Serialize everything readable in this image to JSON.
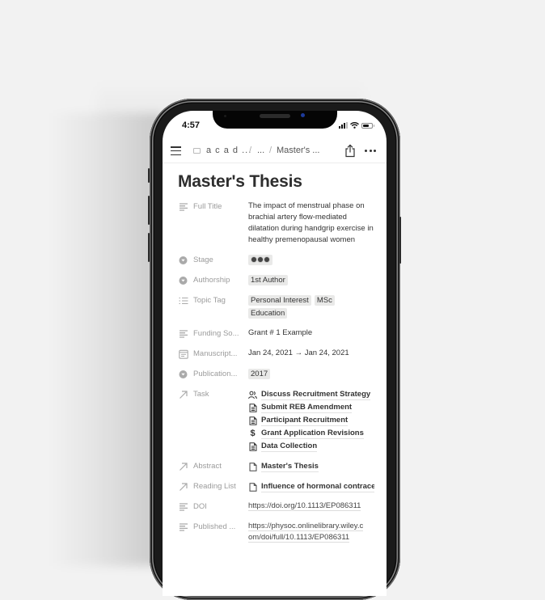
{
  "status_bar": {
    "time": "4:57"
  },
  "topbar": {
    "breadcrumb": [
      "a c a d ...",
      "/",
      "...",
      "/",
      "Master's ..."
    ],
    "icons": [
      "menu-icon",
      "page-icon",
      "share-icon",
      "more-icon"
    ]
  },
  "page": {
    "title": "Master's Thesis",
    "properties": [
      {
        "icon": "text-icon",
        "label": "Full Title",
        "value": "The impact of menstrual phase on brachial artery flow-mediated dilatation during handgrip exercise in healthy premenopausal women"
      },
      {
        "icon": "select-icon",
        "label": "Stage",
        "tag": "●●●"
      },
      {
        "icon": "select-icon",
        "label": "Authorship",
        "tag": "1st Author"
      },
      {
        "icon": "list-icon",
        "label": "Topic Tag",
        "tags": [
          "Personal Interest",
          "MSc",
          "Education"
        ]
      },
      {
        "icon": "text-icon",
        "label": "Funding So...",
        "value": "Grant # 1 Example"
      },
      {
        "icon": "calendar-icon",
        "label": "Manuscript...",
        "value": "Jan 24, 2021 → Jan 24, 2021"
      },
      {
        "icon": "select-icon",
        "label": "Publication...",
        "tag": "2017"
      },
      {
        "icon": "relation-icon",
        "label": "Task",
        "items": [
          {
            "icon": "people-icon",
            "text": "Discuss Recruitment Strategy"
          },
          {
            "icon": "document-icon",
            "text": "Submit REB Amendment"
          },
          {
            "icon": "document-icon",
            "text": "Participant Recruitment"
          },
          {
            "icon": "dollar-icon",
            "text": "Grant Application Revisions"
          },
          {
            "icon": "document-icon",
            "text": "Data Collection"
          }
        ]
      },
      {
        "icon": "relation-icon",
        "label": "Abstract",
        "items": [
          {
            "icon": "page-icon",
            "text": "Master's Thesis"
          }
        ]
      },
      {
        "icon": "relation-icon",
        "label": "Reading List",
        "items": [
          {
            "icon": "page-icon",
            "text": "Influence of hormonal contracep"
          }
        ]
      },
      {
        "icon": "text-icon",
        "label": "DOI",
        "url_lines": [
          "https://doi.org/10.1113/EP086311"
        ]
      },
      {
        "icon": "text-icon",
        "label": "Published ...",
        "url_lines": [
          "https://physoc.onlinelibrary.wiley.c",
          "om/doi/full/10.1113/EP086311"
        ]
      }
    ]
  },
  "colors": {
    "background": "#f2f2f2",
    "tag_bg": "#e9e9e8",
    "label": "#9b9b9b",
    "text": "#333333",
    "camera": "#1d3a9a"
  }
}
